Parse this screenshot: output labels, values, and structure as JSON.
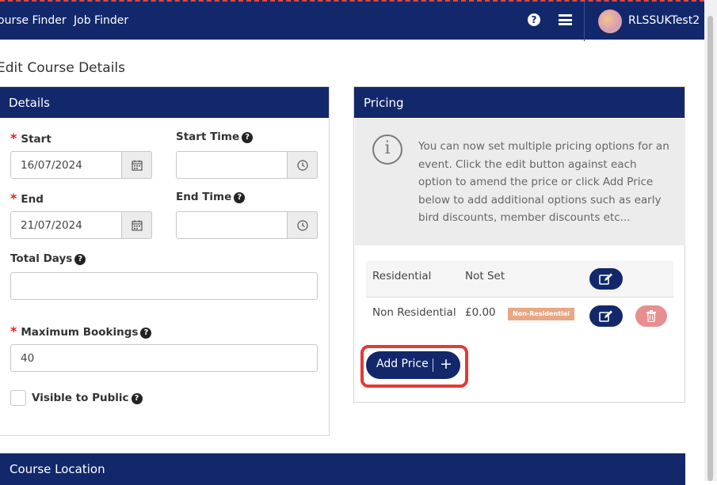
{
  "topbar": {
    "nav": [
      "ourse Finder",
      "Job Finder"
    ],
    "help_icon": "question-circle-icon",
    "menu_icon": "hamburger-icon",
    "username": "RLSSUKTest2"
  },
  "page_title": "Edit Course Details",
  "details": {
    "heading": "Details",
    "start_label": "Start",
    "start_value": "16/07/2024",
    "start_time_label": "Start Time",
    "start_time_value": "",
    "end_label": "End",
    "end_value": "21/07/2024",
    "end_time_label": "End Time",
    "end_time_value": "",
    "total_days_label": "Total Days",
    "total_days_value": "",
    "max_bookings_label": "Maximum Bookings",
    "max_bookings_value": "40",
    "visible_label": "Visible to Public",
    "required_mark": "*",
    "help_glyph": "?"
  },
  "pricing": {
    "heading": "Pricing",
    "info_glyph": "i",
    "info_text": "You can now set multiple pricing options for an event. Click the edit button against each option to amend the price or click Add Price below to add additional options such as early bird discounts, member discounts etc...",
    "rows": [
      {
        "name": "Residential",
        "price": "Not Set",
        "badge": ""
      },
      {
        "name": "Non Residential",
        "price": "£0.00",
        "badge": "Non-Residential"
      }
    ],
    "add_price_label": "Add Price",
    "add_price_plus": "+"
  },
  "location": {
    "heading": "Course Location"
  },
  "colors": {
    "navy": "#13286b",
    "danger": "#e53935",
    "badge": "#e8a784"
  }
}
